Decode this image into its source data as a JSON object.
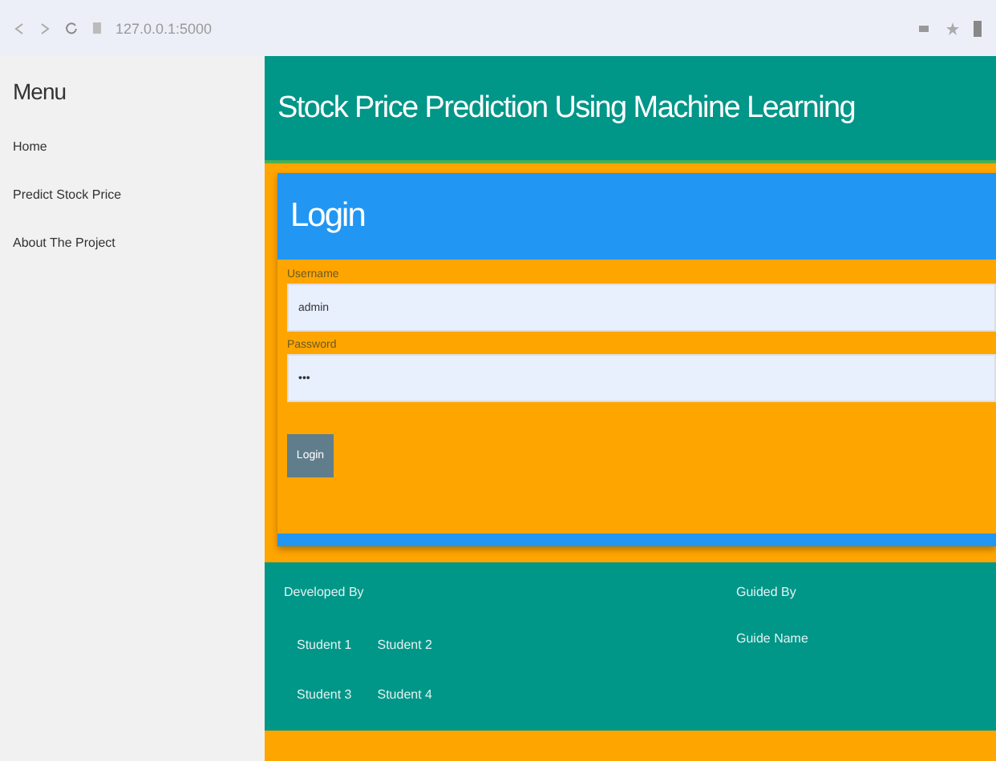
{
  "browser": {
    "url": "127.0.0.1:5000"
  },
  "sidebar": {
    "title": "Menu",
    "items": [
      {
        "label": "Home"
      },
      {
        "label": "Predict Stock Price"
      },
      {
        "label": "About The Project"
      }
    ]
  },
  "header": {
    "title": "Stock Price Prediction Using Machine Learning"
  },
  "login": {
    "title": "Login",
    "fields": [
      {
        "label": "Username",
        "value": "admin"
      },
      {
        "label": "Password",
        "value": "•••"
      }
    ],
    "button": "Login"
  },
  "footer": {
    "developed_by": {
      "title": "Developed By",
      "students": [
        [
          "Student 1",
          "Student 2"
        ],
        [
          "Student 3",
          "Student 4"
        ]
      ]
    },
    "guided_by": {
      "title": "Guided By",
      "guide": "Guide Name"
    }
  }
}
